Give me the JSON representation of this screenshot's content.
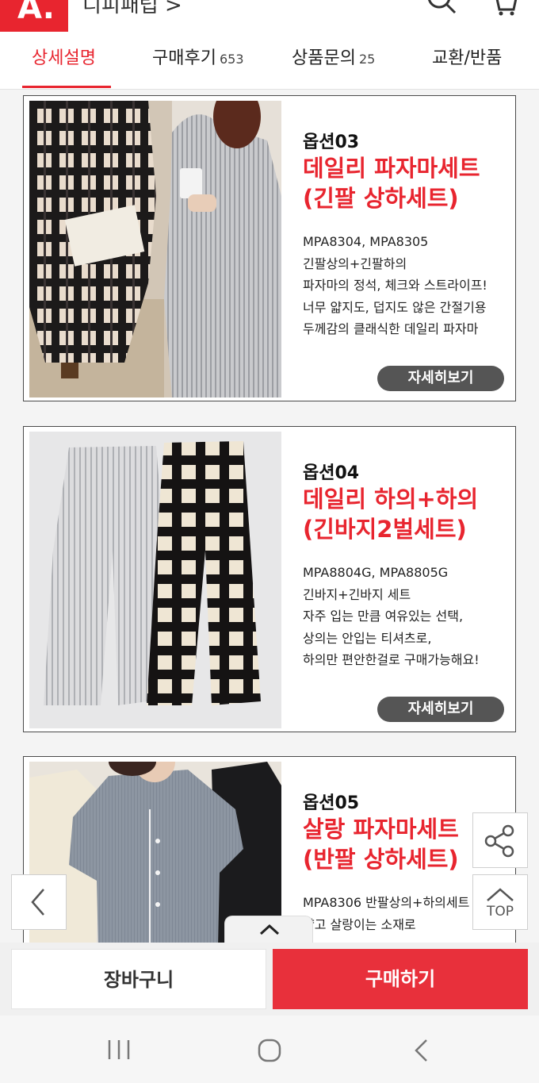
{
  "header": {
    "logo": "A.",
    "shop_name": "디피패럽 >"
  },
  "tabs": [
    {
      "label": "상세설명",
      "count": ""
    },
    {
      "label": "구매후기",
      "count": "653"
    },
    {
      "label": "상품문의",
      "count": "25"
    },
    {
      "label": "교환/반품",
      "count": ""
    }
  ],
  "products": [
    {
      "option": "옵션03",
      "title1": "데일리 파자마세트",
      "title2": "(긴팔 상하세트)",
      "desc": [
        "MPA8304, MPA8305",
        "긴팔상의+긴팔하의",
        "파자마의 정석, 체크와 스트라이프!",
        "너무 얇지도, 덥지도 않은 간절기용",
        "두께감의 클래식한 데일리 파자마"
      ],
      "button": "자세히보기"
    },
    {
      "option": "옵션04",
      "title1": "데일리 하의+하의",
      "title2": "(긴바지2벌세트)",
      "desc": [
        "MPA8804G, MPA8805G",
        "긴바지+긴바지 세트",
        "자주 입는 만큼 여유있는 선택,",
        "상의는 안입는 티셔츠로,",
        "하의만 편안한걸로 구매가능해요!"
      ],
      "button": "자세히보기"
    },
    {
      "option": "옵션05",
      "title1": "살랑 파자마세트",
      "title2": "(반팔 상하세트)",
      "desc": [
        "MPA8306 반팔상의+하의세트",
        "얇고 살랑이는 소재로"
      ],
      "button": ""
    }
  ],
  "floating": {
    "top_label": "TOP"
  },
  "bottom": {
    "cart": "장바구니",
    "buy": "구매하기"
  },
  "colors": {
    "accent": "#e8252f",
    "button_dark": "#555555"
  },
  "icons": [
    "search-icon",
    "cart-icon",
    "share-icon",
    "chevron-up-icon",
    "chevron-left-icon",
    "recent-apps-icon",
    "home-icon",
    "back-icon"
  ]
}
